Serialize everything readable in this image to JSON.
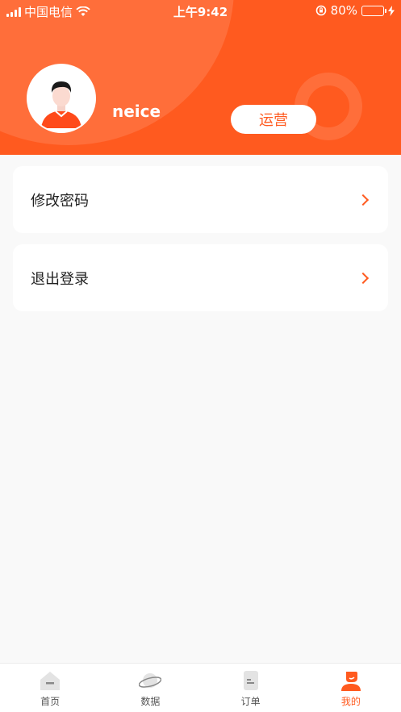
{
  "status_bar": {
    "carrier": "中国电信",
    "time": "上午9:42",
    "battery_percent": "80%",
    "battery_level": 0.8
  },
  "profile": {
    "username": "neice",
    "role_label": "运营"
  },
  "menu": [
    {
      "label": "修改密码"
    },
    {
      "label": "退出登录"
    }
  ],
  "tabbar": {
    "tabs": [
      {
        "label": "首页",
        "icon": "home-icon",
        "active": false
      },
      {
        "label": "数据",
        "icon": "planet-icon",
        "active": false
      },
      {
        "label": "订单",
        "icon": "document-icon",
        "active": false
      },
      {
        "label": "我的",
        "icon": "user-icon",
        "active": true
      }
    ]
  },
  "colors": {
    "accent": "#ff5a1f",
    "background": "#f9f9f9",
    "battery": "#4cd964"
  }
}
